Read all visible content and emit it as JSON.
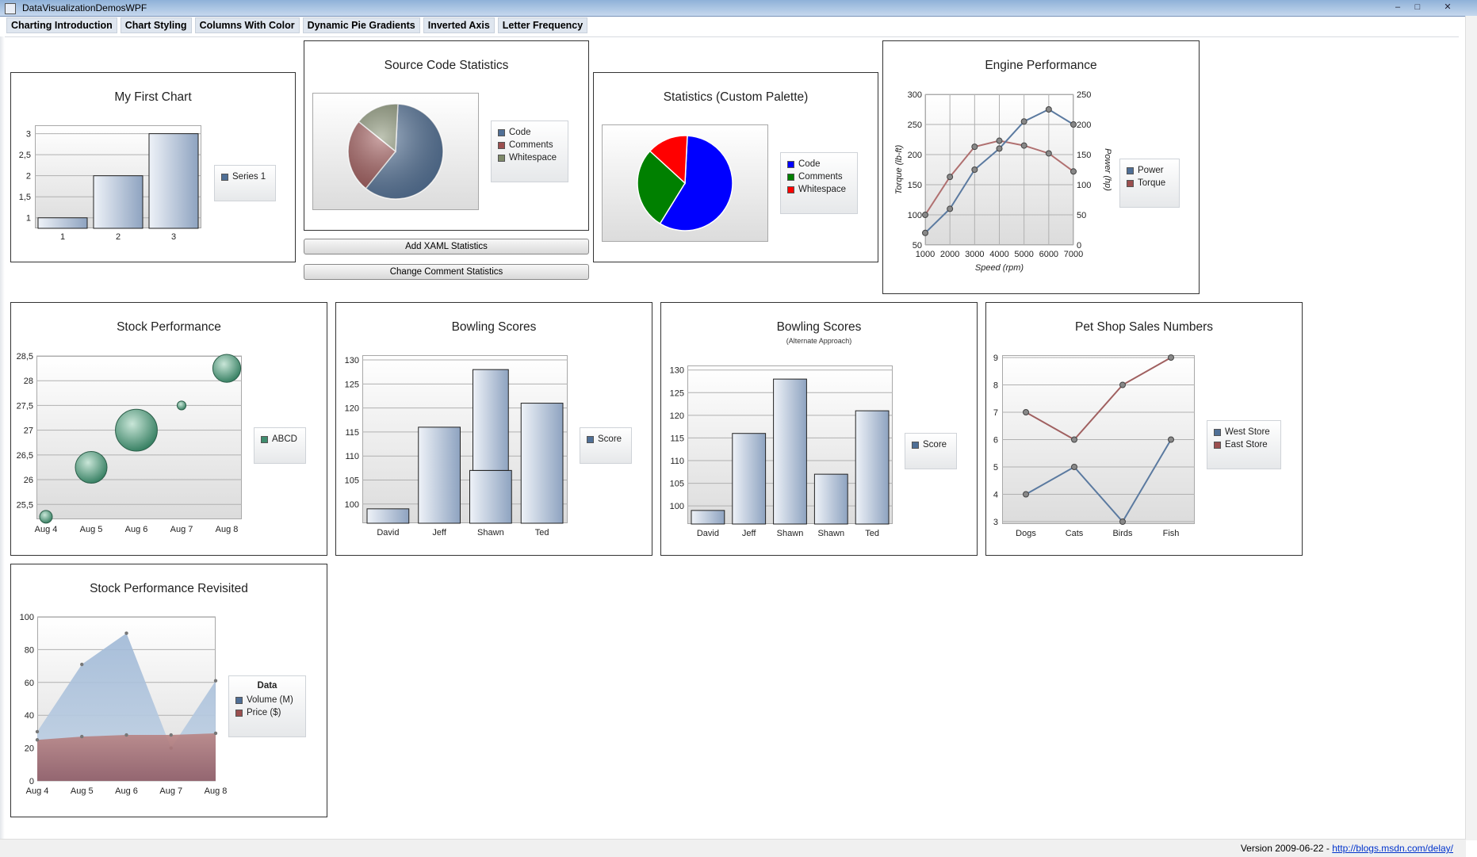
{
  "window": {
    "title": "DataVisualizationDemosWPF",
    "min": "–",
    "max": "□",
    "close": "✕"
  },
  "tabs": [
    "Charting Introduction",
    "Chart Styling",
    "Columns With Color",
    "Dynamic Pie Gradients",
    "Inverted Axis",
    "Letter Frequency"
  ],
  "buttons": {
    "add_xaml": "Add XAML Statistics",
    "change_comment": "Change Comment Statistics"
  },
  "status": {
    "version": "Version 2009-06-22 - ",
    "link": "http://blogs.msdn.com/delay/"
  },
  "colors": {
    "blue_fill": "#4f6f96",
    "red_fill": "#9b4f4f",
    "green_bubble": "#3f8c6e",
    "custom_blue": "#0000ff",
    "custom_green": "#008000",
    "custom_red": "#ff0000"
  },
  "charts": {
    "first": {
      "title": "My First Chart",
      "legend": [
        "Series 1"
      ]
    },
    "source": {
      "title": "Source Code Statistics",
      "legend": [
        "Code",
        "Comments",
        "Whitespace"
      ]
    },
    "custom": {
      "title": "Statistics (Custom Palette)",
      "legend": [
        "Code",
        "Comments",
        "Whitespace"
      ]
    },
    "engine": {
      "title": "Engine Performance",
      "xlabel": "Speed (rpm)",
      "ylabel": "Torque (lb-ft)",
      "y2label": "Power (hp)",
      "legend": [
        "Power",
        "Torque"
      ]
    },
    "stock": {
      "title": "Stock Performance",
      "legend": [
        "ABCD"
      ]
    },
    "bowl1": {
      "title": "Bowling Scores",
      "legend": [
        "Score"
      ]
    },
    "bowl2": {
      "title": "Bowling Scores",
      "subtitle": "(Alternate Approach)",
      "legend": [
        "Score"
      ]
    },
    "pet": {
      "title": "Pet Shop Sales Numbers",
      "legend": [
        "West Store",
        "East Store"
      ]
    },
    "revisited": {
      "title": "Stock Performance Revisited",
      "legend_title": "Data",
      "legend": [
        "Volume (M)",
        "Price ($)"
      ]
    }
  },
  "chart_data": [
    {
      "id": "first",
      "type": "bar",
      "title": "My First Chart",
      "categories": [
        "1",
        "2",
        "3"
      ],
      "series": [
        {
          "name": "Series 1",
          "values": [
            1,
            2,
            3
          ]
        }
      ],
      "ylim": [
        0.75,
        3.2
      ],
      "yticks": [
        "1",
        "1,5",
        "2",
        "2,5",
        "3"
      ]
    },
    {
      "id": "source",
      "type": "pie",
      "title": "Source Code Statistics",
      "categories": [
        "Code",
        "Comments",
        "Whitespace"
      ],
      "values": [
        60,
        25,
        15
      ]
    },
    {
      "id": "custom",
      "type": "pie",
      "title": "Statistics (Custom Palette)",
      "categories": [
        "Code",
        "Comments",
        "Whitespace"
      ],
      "values": [
        58,
        28,
        14
      ]
    },
    {
      "id": "engine",
      "type": "line",
      "title": "Engine Performance",
      "x": [
        1000,
        2000,
        3000,
        4000,
        5000,
        6000,
        7000
      ],
      "xlabel": "Speed (rpm)",
      "ylabel": "Torque (lb-ft)",
      "y2label": "Power (hp)",
      "series": [
        {
          "name": "Power",
          "axis": "right",
          "values": [
            20,
            60,
            125,
            160,
            205,
            225,
            200
          ]
        },
        {
          "name": "Torque",
          "axis": "left",
          "values": [
            100,
            163,
            213,
            223,
            215,
            202,
            172
          ]
        }
      ],
      "ylim": [
        50,
        300
      ],
      "y2lim": [
        0,
        250
      ]
    },
    {
      "id": "stock",
      "type": "scatter",
      "title": "Stock Performance",
      "categories": [
        "Aug 4",
        "Aug 5",
        "Aug 6",
        "Aug 7",
        "Aug 8"
      ],
      "series": [
        {
          "name": "ABCD",
          "values": [
            25.25,
            26.25,
            27.0,
            27.5,
            28.25
          ],
          "sizes": [
            1,
            2.5,
            3.3,
            0.7,
            2.2
          ]
        }
      ],
      "ylim": [
        25.2,
        28.5
      ],
      "yticks": [
        "25,5",
        "26",
        "26,5",
        "27",
        "27,5",
        "28",
        "28,5"
      ]
    },
    {
      "id": "bowl1",
      "type": "bar",
      "title": "Bowling Scores",
      "categories": [
        "David",
        "Jeff",
        "Shawn",
        "Ted"
      ],
      "series": [
        {
          "name": "Score",
          "values": [
            99,
            116,
            107,
            121
          ]
        },
        {
          "name": "Score",
          "values": [
            0,
            0,
            128,
            0
          ]
        }
      ],
      "ylim": [
        96,
        131
      ]
    },
    {
      "id": "bowl2",
      "type": "bar",
      "title": "Bowling Scores",
      "subtitle": "(Alternate Approach)",
      "categories": [
        "David",
        "Jeff",
        "Shawn",
        "Shawn",
        "Ted"
      ],
      "series": [
        {
          "name": "Score",
          "values": [
            99,
            116,
            128,
            107,
            121
          ]
        }
      ],
      "ylim": [
        96,
        131
      ]
    },
    {
      "id": "pet",
      "type": "line",
      "title": "Pet Shop Sales Numbers",
      "categories": [
        "Dogs",
        "Cats",
        "Birds",
        "Fish"
      ],
      "series": [
        {
          "name": "West Store",
          "values": [
            4,
            5,
            3,
            6
          ]
        },
        {
          "name": "East Store",
          "values": [
            7,
            6,
            8,
            9
          ]
        }
      ],
      "ylim": [
        3,
        9
      ]
    },
    {
      "id": "revisited",
      "type": "area",
      "title": "Stock Performance Revisited",
      "categories": [
        "Aug 4",
        "Aug 5",
        "Aug 6",
        "Aug 7",
        "Aug 8"
      ],
      "series": [
        {
          "name": "Volume (M)",
          "values": [
            30,
            71,
            90,
            20,
            61
          ]
        },
        {
          "name": "Price ($)",
          "values": [
            25,
            27,
            28,
            28,
            29
          ]
        }
      ],
      "ylim": [
        0,
        100
      ]
    }
  ]
}
